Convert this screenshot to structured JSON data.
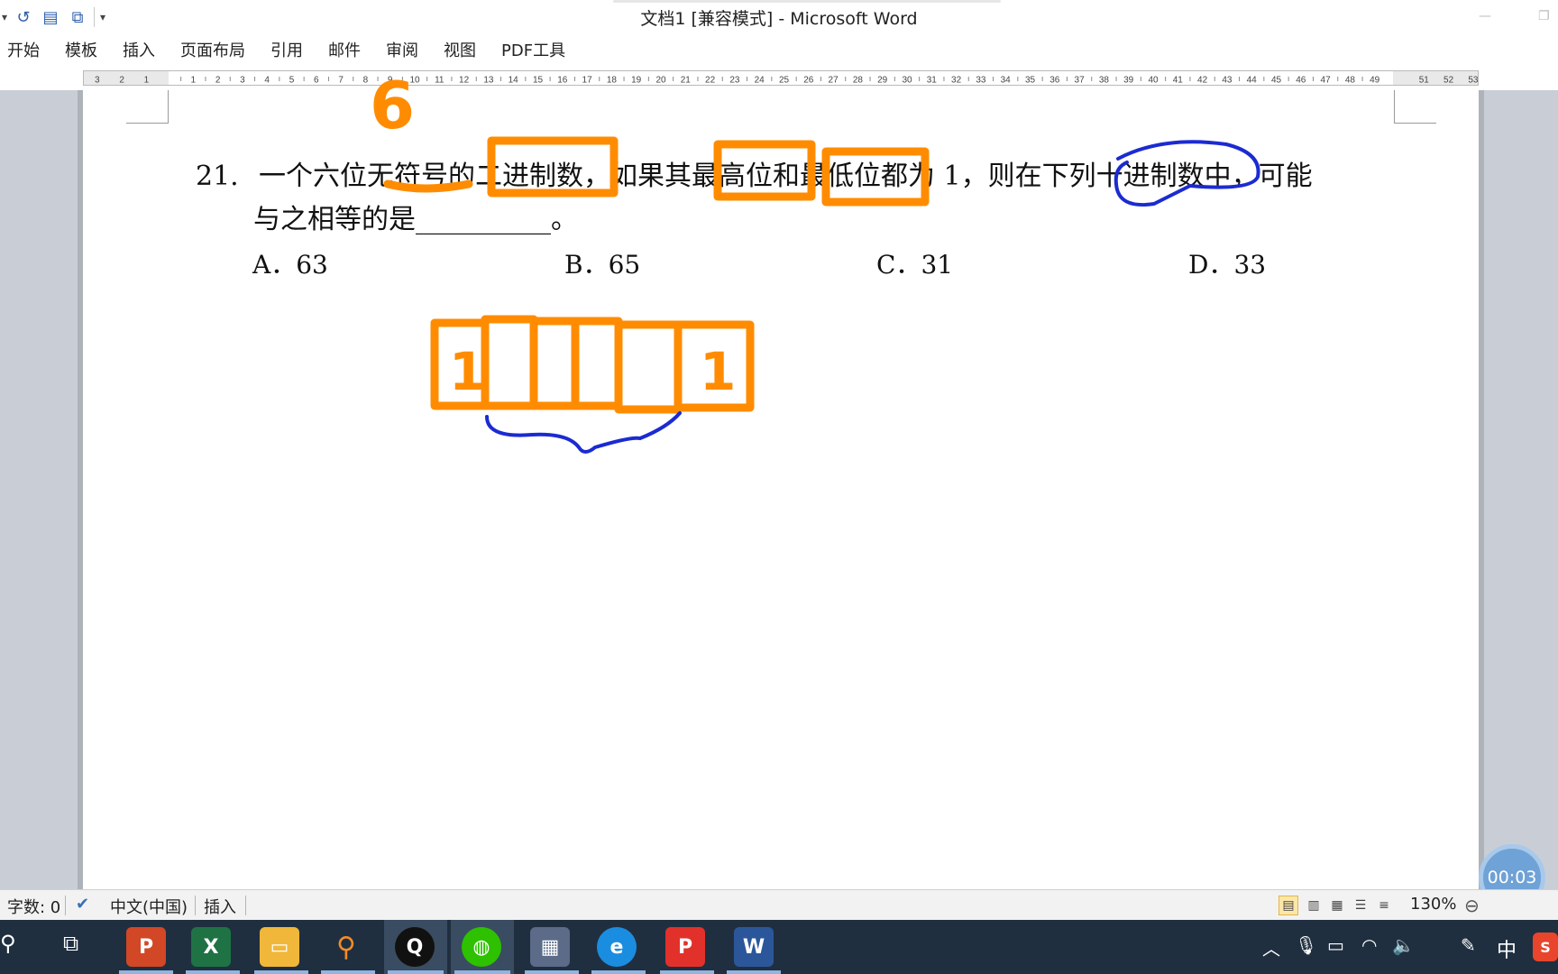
{
  "window": {
    "title": "文档1 [兼容模式] - Microsoft Word"
  },
  "menu": [
    "开始",
    "模板",
    "插入",
    "页面布局",
    "引用",
    "邮件",
    "审阅",
    "视图",
    "PDF工具"
  ],
  "ruler": {
    "left_labels": [
      "3",
      "2",
      "1"
    ],
    "numbers": [
      "1",
      "2",
      "3",
      "4",
      "5",
      "6",
      "7",
      "8",
      "9",
      "10",
      "11",
      "12",
      "13",
      "14",
      "15",
      "16",
      "17",
      "18",
      "19",
      "20",
      "21",
      "22",
      "23",
      "24",
      "25",
      "26",
      "27",
      "28",
      "29",
      "30",
      "31",
      "32",
      "33",
      "34",
      "35",
      "36",
      "37",
      "38",
      "39",
      "40",
      "41",
      "42",
      "43",
      "44",
      "45",
      "46",
      "47",
      "48",
      "49"
    ],
    "right_labels": [
      "51",
      "52",
      "53"
    ]
  },
  "document": {
    "question_number": "21.",
    "question_line1": "一个六位无符号的二进制数，如果其最高位和最低位都为 1，则在下列十进制数中，可能",
    "question_line2": "与之相等的是__________。",
    "options": [
      {
        "label": "A．",
        "value": "63"
      },
      {
        "label": "B．",
        "value": "65"
      },
      {
        "label": "C．",
        "value": "31"
      },
      {
        "label": "D．",
        "value": "33"
      }
    ]
  },
  "annotations": {
    "digit_six": "6",
    "box_first": "1",
    "box_last": "1",
    "orange": "#ff8c00",
    "blue": "#1b2bd1"
  },
  "timer": "00:03",
  "status": {
    "word_count": "字数: 0",
    "language": "中文(中国)",
    "mode": "插入",
    "zoom": "130%"
  },
  "taskbar": {
    "apps": [
      "powerpoint-icon",
      "excel-icon",
      "file-explorer-icon",
      "search-tool-icon",
      "qq-icon",
      "wechat-icon",
      "calculator-icon",
      "edge-icon",
      "pdf-icon",
      "word-icon"
    ],
    "ime": "中"
  }
}
